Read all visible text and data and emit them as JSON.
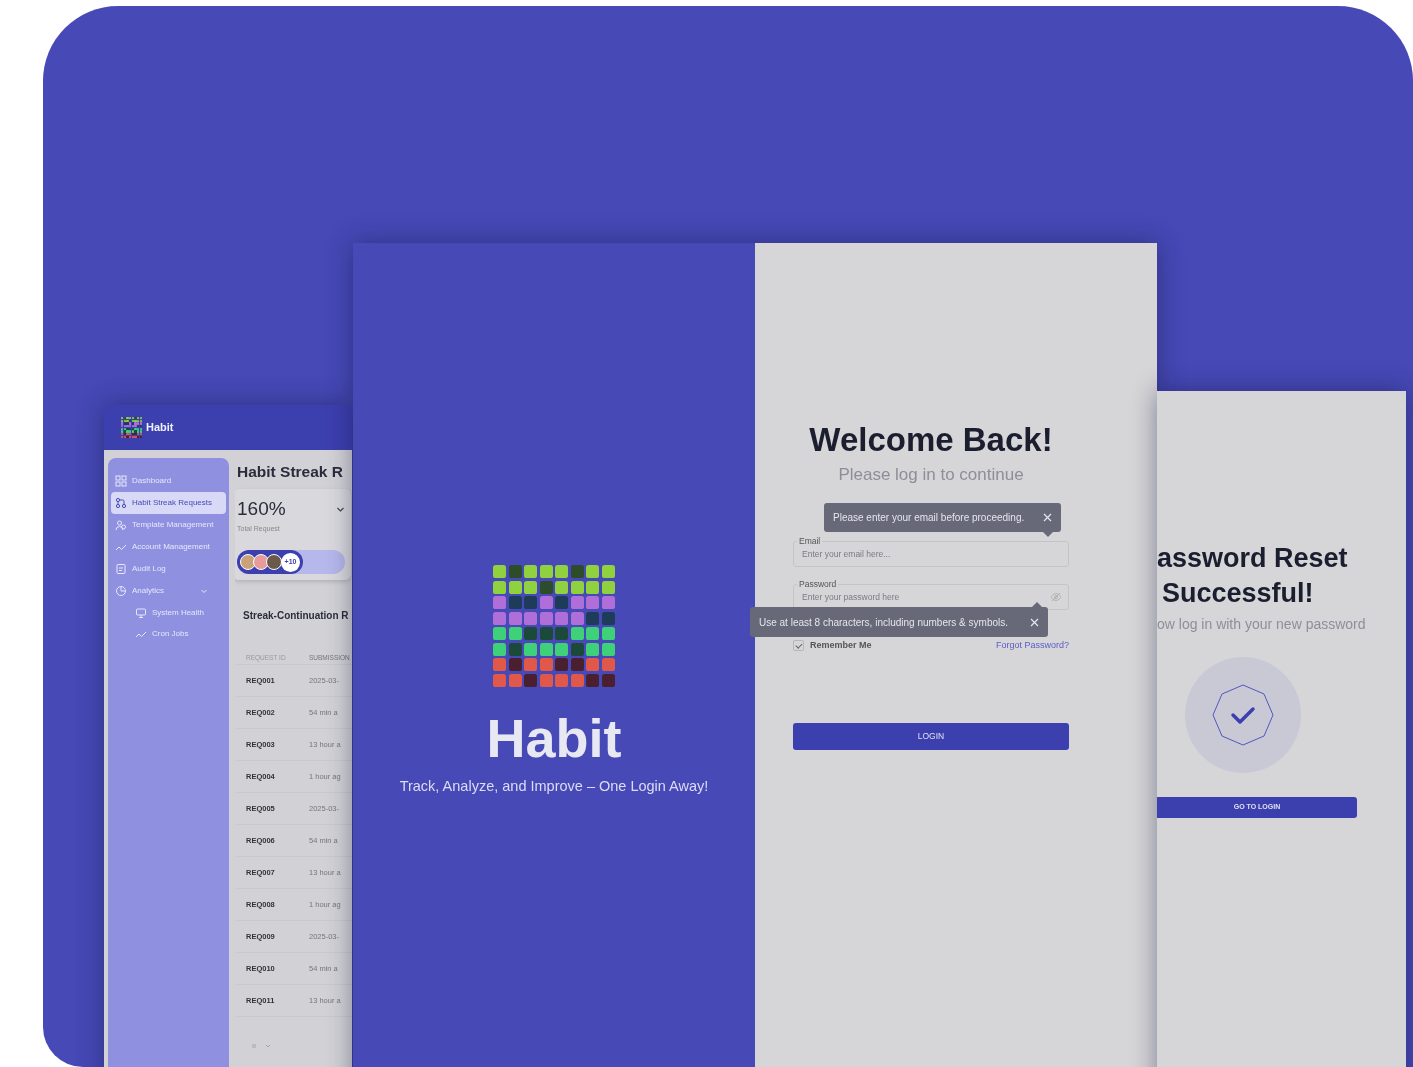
{
  "dashboard": {
    "brand": "Habit",
    "nav": [
      {
        "label": "Dashboard",
        "selected": false
      },
      {
        "label": "Habit Streak Requests",
        "selected": true
      },
      {
        "label": "Template Management",
        "selected": false
      },
      {
        "label": "Account Management",
        "selected": false
      },
      {
        "label": "Audit Log",
        "selected": false
      },
      {
        "label": "Analytics",
        "selected": false,
        "expanded": true,
        "children": [
          {
            "label": "System Health",
            "selected": false
          },
          {
            "label": "Cron Jobs",
            "selected": false
          }
        ]
      }
    ],
    "title": "Habit Streak R",
    "stat": {
      "value": "160%",
      "label": "Total Request"
    },
    "avatars_more": "+10",
    "section_title": "Streak-Continuation R",
    "table": {
      "columns": [
        "REQUEST ID",
        "SUBMISSION"
      ],
      "rows": [
        [
          "REQ001",
          "2025-03-"
        ],
        [
          "REQ002",
          "54 min a"
        ],
        [
          "REQ003",
          "13 hour a"
        ],
        [
          "REQ004",
          "1 hour ag"
        ],
        [
          "REQ005",
          "2025-03-"
        ],
        [
          "REQ006",
          "54 min a"
        ],
        [
          "REQ007",
          "13 hour a"
        ],
        [
          "REQ008",
          "1 hour ag"
        ],
        [
          "REQ009",
          "2025-03-"
        ],
        [
          "REQ010",
          "54 min a"
        ],
        [
          "REQ011",
          "13 hour a"
        ]
      ]
    }
  },
  "login": {
    "brand": "Habit",
    "tagline": "Track, Analyze, and Improve – One Login Away!",
    "title": "Welcome Back!",
    "subtitle": "Please log in to continue",
    "email": {
      "label": "Email",
      "placeholder": "Enter your email here..."
    },
    "password": {
      "label": "Password",
      "placeholder": "Enter your password here"
    },
    "tooltips": [
      "Please enter your email before proceeding.",
      "Use at least 8 characters, including numbers & symbols."
    ],
    "remember": {
      "label": "Remember Me",
      "checked": true
    },
    "forgot": "Forgot Password?",
    "button": "LOGIN"
  },
  "reset": {
    "title_lines": [
      "assword Reset",
      "Successful!"
    ],
    "subtitle": "ow log in with your new password",
    "button": "GO TO LOGIN"
  }
}
